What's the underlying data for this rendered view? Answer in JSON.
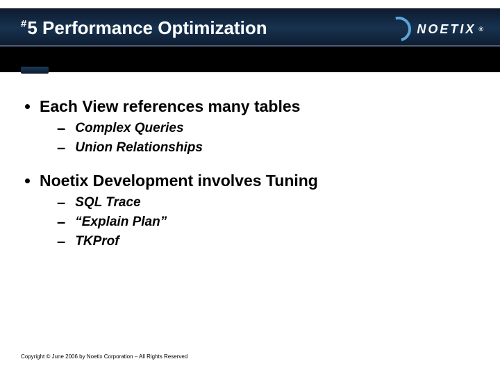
{
  "header": {
    "hash": "#",
    "number": "5",
    "title_rest": " Performance Optimization",
    "logo_text": "NOETIX",
    "logo_reg": "®"
  },
  "bullets": [
    {
      "text": "Each View references many tables",
      "sub": [
        "Complex Queries",
        "Union Relationships"
      ]
    },
    {
      "text": "Noetix Development involves Tuning",
      "sub": [
        "SQL Trace",
        "“Explain Plan”",
        "TKProf"
      ]
    }
  ],
  "footer": "Copyright © June 2006 by Noetix Corporation – All Rights Reserved"
}
